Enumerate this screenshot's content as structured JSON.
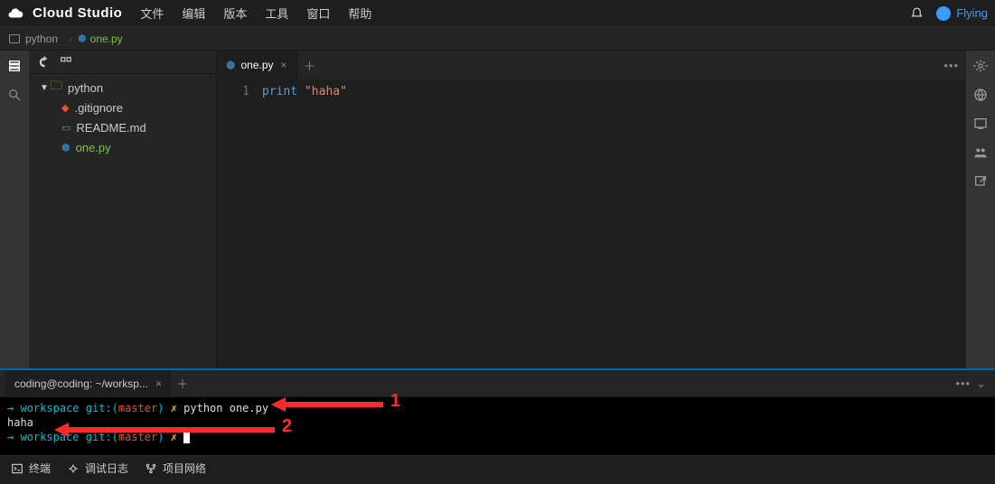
{
  "menubar": {
    "brand": "Cloud Studio",
    "items": [
      "文件",
      "编辑",
      "版本",
      "工具",
      "窗口",
      "帮助"
    ],
    "username": "Flying"
  },
  "breadcrumb": {
    "folder": "python",
    "file": "one.py"
  },
  "sidebar": {
    "root": "python",
    "files": [
      {
        "name": ".gitignore",
        "type": "git"
      },
      {
        "name": "README.md",
        "type": "md"
      },
      {
        "name": "one.py",
        "type": "py",
        "active": true
      }
    ]
  },
  "editor": {
    "tab_label": "one.py",
    "line_number": "1",
    "code_keyword": "print",
    "code_string": "\"haha\""
  },
  "terminal": {
    "tab_label": "coding@coding: ~/worksp...",
    "line1": {
      "arrow": "→",
      "ws": "workspace",
      "git": "git:(",
      "branch": "master",
      "gitend": ")",
      "x": "✗",
      "cmd": "python one.py"
    },
    "output1": "haha",
    "line2": {
      "arrow": "→",
      "ws": "workspace",
      "git": "git:(",
      "branch": "master",
      "gitend": ")",
      "x": "✗"
    },
    "annotations": {
      "label1": "1",
      "label2": "2"
    }
  },
  "statusbar": {
    "terminal": "终端",
    "debug": "调试日志",
    "network": "项目网络"
  }
}
